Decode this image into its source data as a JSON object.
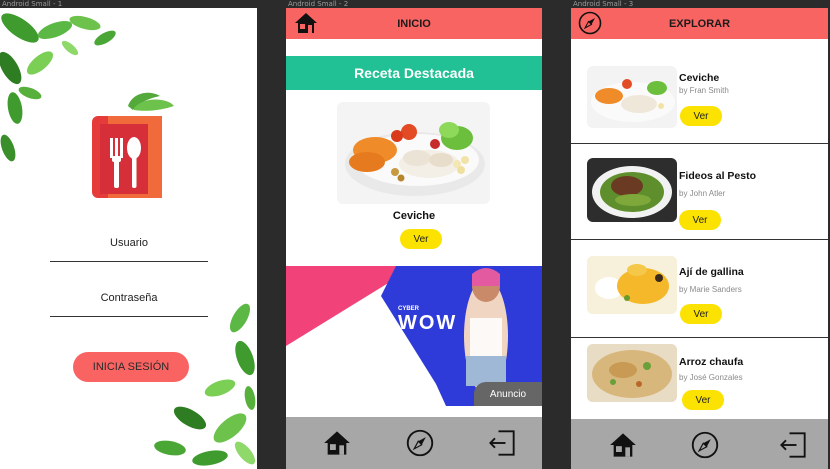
{
  "frames": [
    "Android Small - 1",
    "Android Small - 2",
    "Android Small - 3"
  ],
  "login": {
    "username_label": "Usuario",
    "password_label": "Contraseña",
    "login_button": "INICIA SESIÓN"
  },
  "home": {
    "header_title": "INICIO",
    "featured_title": "Receta Destacada",
    "featured_recipe": "Ceviche",
    "view_button": "Ver",
    "ad": {
      "brand_small": "CYBER",
      "brand_big": "WOW",
      "label": "Anuncio"
    }
  },
  "explore": {
    "header_title": "EXPLORAR",
    "recipes": [
      {
        "title": "Ceviche",
        "author": "by Fran Smith",
        "button": "Ver"
      },
      {
        "title": "Fideos al Pesto",
        "author": "by John Atler",
        "button": "Ver"
      },
      {
        "title": "Ají de gallina",
        "author": "by Marie Sanders",
        "button": "Ver"
      },
      {
        "title": "Arroz chaufa",
        "author": "by José Gonzales",
        "button": "Ver"
      }
    ]
  },
  "nav": {
    "icons": [
      "home-icon",
      "compass-icon",
      "logout-icon"
    ]
  },
  "colors": {
    "header": "#f86461",
    "featured_band": "#22c095",
    "button_yellow": "#fbe200",
    "login_button": "#f96462",
    "navbar": "#a7a7a7"
  }
}
